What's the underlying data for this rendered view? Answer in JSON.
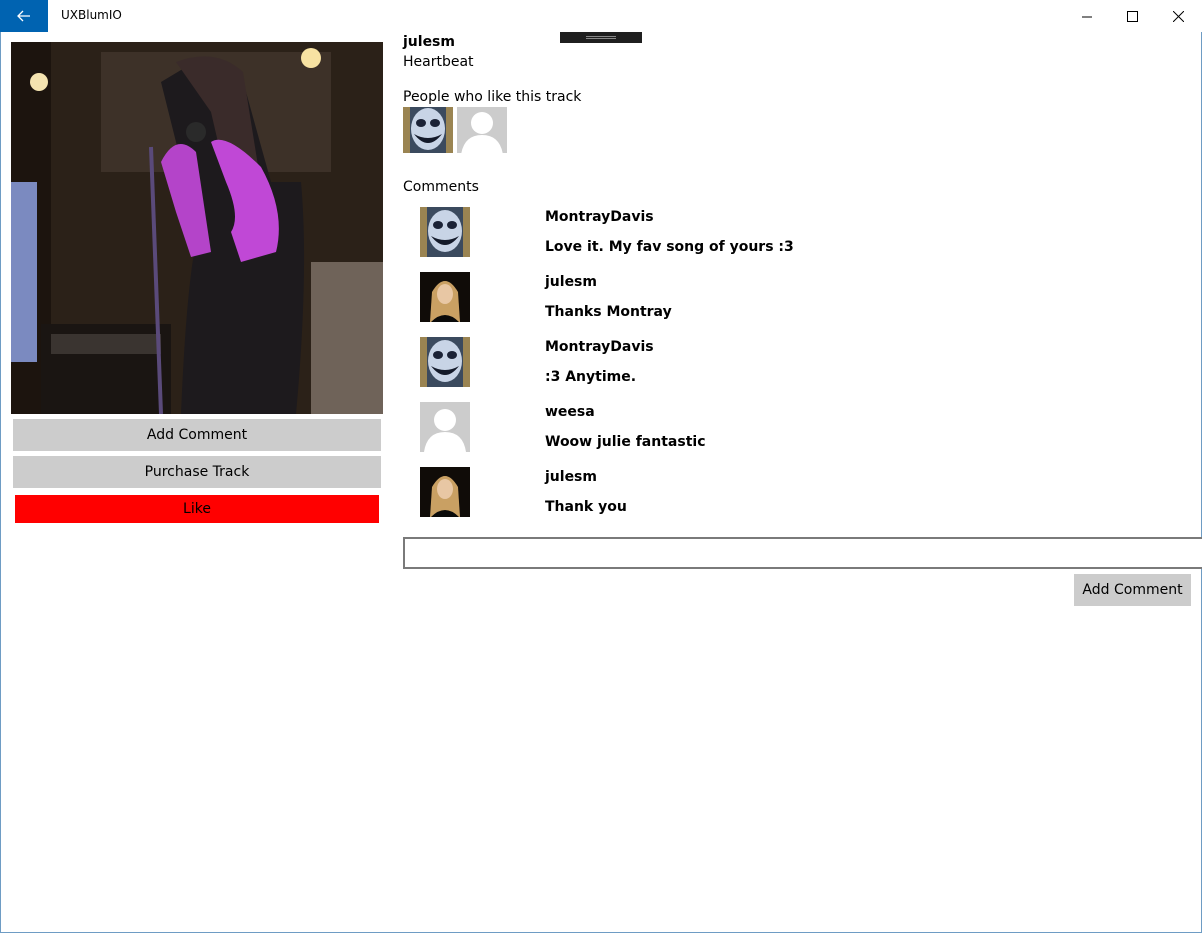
{
  "window": {
    "title": "UXBlumIO",
    "back_icon": "back-arrow-icon",
    "accent": "#0063b1"
  },
  "track": {
    "artist": "julesm",
    "title": "Heartbeat"
  },
  "left_panel": {
    "add_comment_label": "Add Comment",
    "purchase_label": "Purchase Track",
    "like_label": "Like",
    "like_color": "#ff0000"
  },
  "likes": {
    "label": "People who like this track"
  },
  "comments": {
    "label": "Comments",
    "items": [
      {
        "user": "MontrayDavis",
        "text": "Love it. My fav song of yours :3",
        "avatar": "painted-face"
      },
      {
        "user": "julesm",
        "text": "Thanks Montray",
        "avatar": "woman-photo"
      },
      {
        "user": "MontrayDavis",
        "text": ":3 Anytime.",
        "avatar": "painted-face"
      },
      {
        "user": "weesa",
        "text": "Woow julie fantastic",
        "avatar": "default-person"
      },
      {
        "user": "julesm",
        "text": "Thank you",
        "avatar": "woman-photo"
      }
    ]
  },
  "composer": {
    "input_value": "",
    "add_label": "Add Comment"
  }
}
